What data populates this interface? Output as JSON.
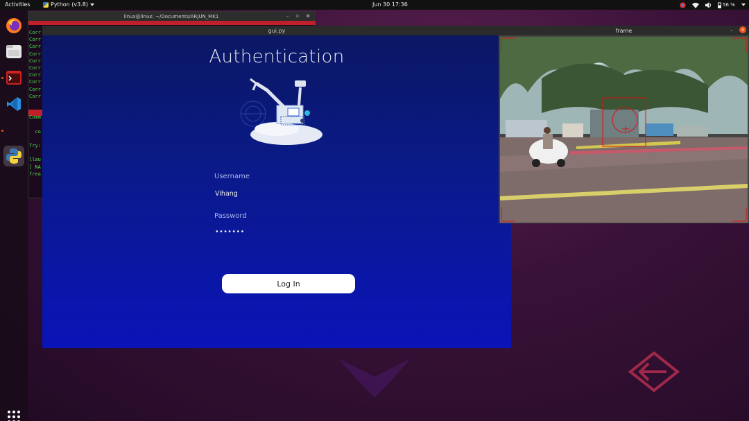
{
  "topbar": {
    "activities": "Activities",
    "app_menu": "Python (v3.8)",
    "clock": "Jun 30  17:36",
    "battery": "56 %"
  },
  "dock": {
    "items": [
      "firefox-icon",
      "files-icon",
      "terminal-icon",
      "vscode-icon",
      "python-icon"
    ],
    "show_apps": "show-applications-icon"
  },
  "terminal": {
    "title": "linux@linux: ~/Documents/ARJUN_MK1",
    "lines": [
      "Corr",
      "Corr",
      "Corr",
      "Corr",
      "Corr",
      "Corr",
      "Corr",
      "Corr",
      "Corr",
      "Corr",
      "",
      "",
      "Comm",
      "",
      "  co",
      "",
      "Try:",
      "",
      "llau",
      "[ NA",
      "frea"
    ]
  },
  "gui_window": {
    "title": "gui.py",
    "heading": "Authentication",
    "username_label": "Username",
    "username_value": "Vihang",
    "password_label": "Password",
    "password_value": "•••••••",
    "login_label": "Log In"
  },
  "frame_window": {
    "title": "frame"
  },
  "colors": {
    "accent": "#e95420",
    "gui_bg_top": "#0b1760",
    "gui_bg_bottom": "#0a14b8",
    "terminal_text": "#4be04b",
    "hud_red": "#e01010"
  }
}
